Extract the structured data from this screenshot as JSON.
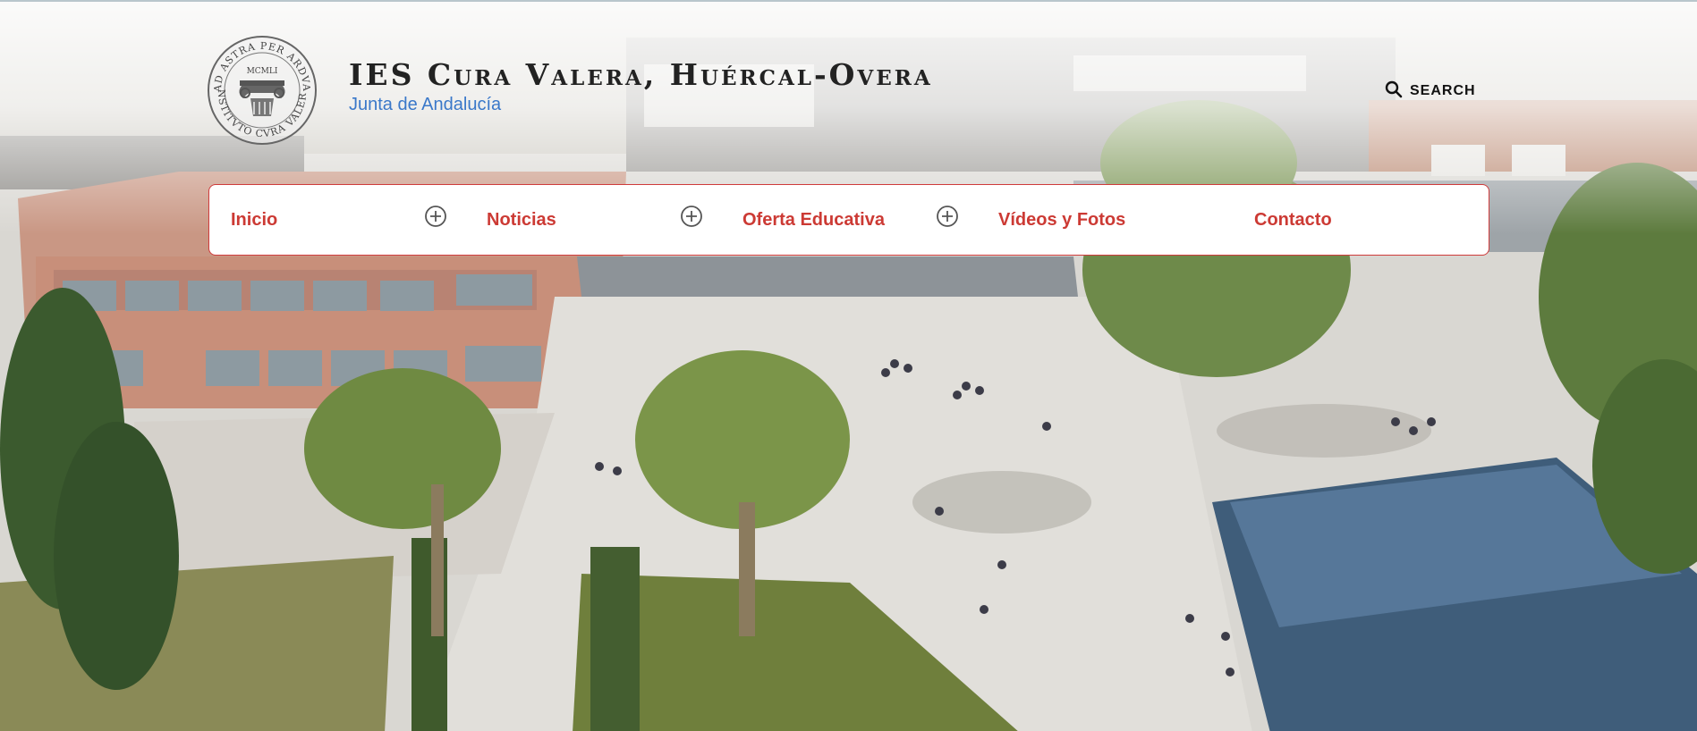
{
  "header": {
    "title": "IES Cura Valera, Huércal-Overa",
    "subtitle": "Junta de Andalucía",
    "logo": {
      "ring_text": "AD ASTRA PER ARDVA · INSTITVTO CVRA VALERA",
      "year": "MCMLI"
    },
    "search_label": "SEARCH",
    "search_icon": "search-icon"
  },
  "nav": {
    "items": [
      {
        "label": "Inicio",
        "has_submenu": true
      },
      {
        "label": "Noticias",
        "has_submenu": true
      },
      {
        "label": "Oferta Educativa",
        "has_submenu": true
      },
      {
        "label": "Vídeos y Fotos",
        "has_submenu": false
      },
      {
        "label": "Contacto",
        "has_submenu": false
      }
    ],
    "submenu_icon": "plus-circle-icon"
  },
  "colors": {
    "accent": "#cc3a34",
    "subtitle": "#3a78c9",
    "title": "#222222"
  }
}
